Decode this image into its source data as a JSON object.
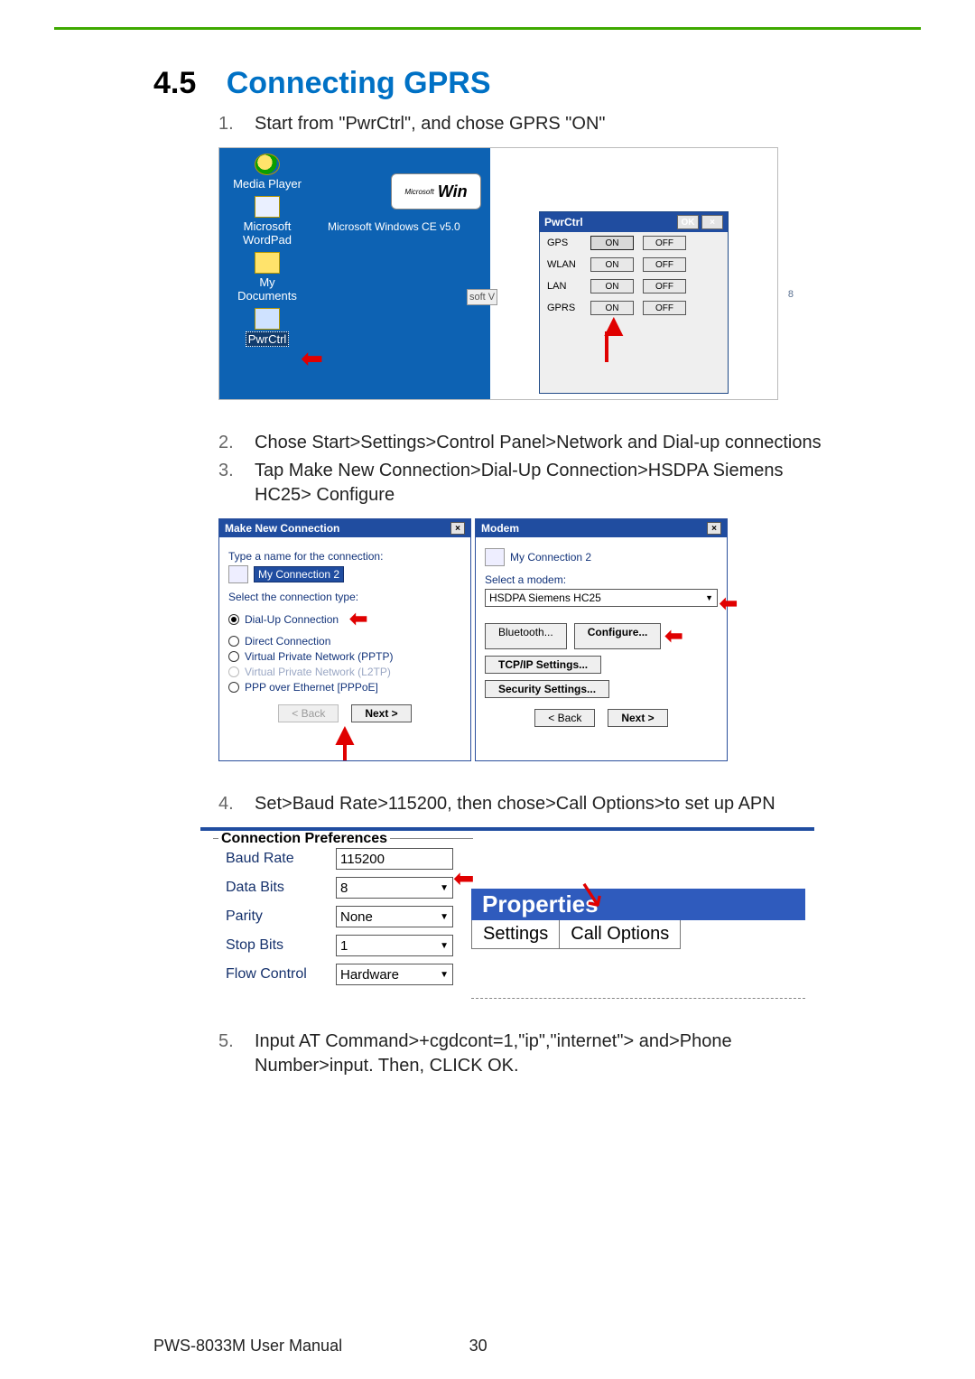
{
  "section": {
    "number": "4.5",
    "title": "Connecting GPRS"
  },
  "steps": {
    "s1_num": "1.",
    "s1": "Start from \"PwrCtrl\", and chose GPRS \"ON\"",
    "s2_num": "2.",
    "s2": "Chose Start>Settings>Control Panel>Network and Dial-up connections",
    "s3_num": "3.",
    "s3": "Tap Make New Connection>Dial-Up Connection>HSDPA Siemens HC25> Configure",
    "s4_num": "4.",
    "s4": "Set>Baud Rate>115200, then chose>Call Options>to set up APN",
    "s5_num": "5.",
    "s5": "Input AT Command>+cgdcont=1,\"ip\",\"internet\"> and>Phone Number>input. Then, CLICK OK."
  },
  "fig1": {
    "desktop": {
      "media": "Media Player",
      "wordpad1": "Microsoft",
      "wordpad2": "WordPad",
      "docs1": "My",
      "docs2": "Documents",
      "pwr": "PwrCtrl",
      "wince": "Microsoft Windows CE v5.0",
      "winlogo_small": "Microsoft",
      "winlogo": "Win"
    },
    "pwrctrl": {
      "title": "PwrCtrl",
      "ok": "OK",
      "x": "×",
      "rows": [
        {
          "label": "GPS",
          "on": "ON",
          "off": "OFF"
        },
        {
          "label": "WLAN",
          "on": "ON",
          "off": "OFF"
        },
        {
          "label": "LAN",
          "on": "ON",
          "off": "OFF"
        },
        {
          "label": "GPRS",
          "on": "ON",
          "off": "OFF"
        }
      ],
      "side_l": "soft V",
      "side_r": "8"
    }
  },
  "fig2": {
    "left": {
      "title": "Make New Connection",
      "x": "×",
      "prompt": "Type a name for the connection:",
      "value": "My Connection 2",
      "select_label": "Select the connection type:",
      "r_dial": "Dial-Up Connection",
      "r_direct": "Direct Connection",
      "r_pptp": "Virtual Private Network (PPTP)",
      "r_l2tp": "Virtual Private Network (L2TP)",
      "r_pppoe": "PPP over Ethernet [PPPoE]",
      "back": "< Back",
      "next": "Next >"
    },
    "right": {
      "title": "Modem",
      "x": "×",
      "conn_name": "My Connection 2",
      "select_modem": "Select a modem:",
      "modem": "HSDPA Siemens HC25",
      "bluetooth": "Bluetooth...",
      "configure": "Configure...",
      "tcpip": "TCP/IP Settings...",
      "security": "Security Settings...",
      "back": "< Back",
      "next": "Next >"
    }
  },
  "fig3": {
    "legend": "Connection Preferences",
    "rows": {
      "baud_l": "Baud Rate",
      "baud_v": "115200",
      "data_l": "Data Bits",
      "data_v": "8",
      "parity_l": "Parity",
      "parity_v": "None",
      "stop_l": "Stop Bits",
      "stop_v": "1",
      "flow_l": "Flow Control",
      "flow_v": "Hardware"
    },
    "right": {
      "props": "Properties",
      "tab1": "Settings",
      "tab2": "Call Options"
    }
  },
  "footer": {
    "left": "PWS-8033M User Manual",
    "page": "30"
  }
}
